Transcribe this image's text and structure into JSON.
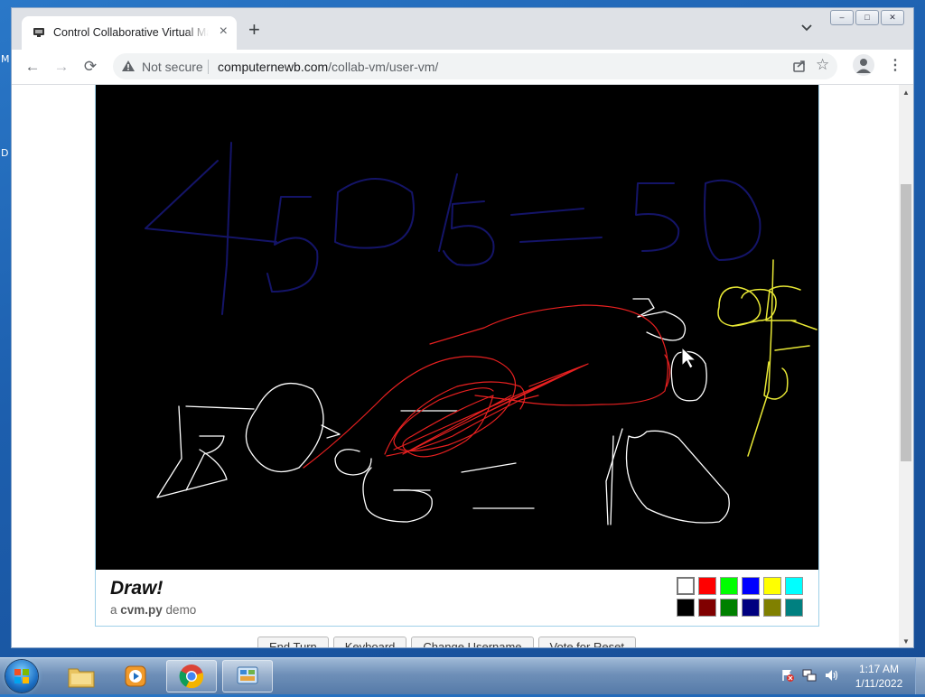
{
  "desktop": {
    "edge_labels": [
      "M",
      "D"
    ]
  },
  "browser": {
    "tab": {
      "title": "Control Collaborative Virtual Ma",
      "close": "×"
    },
    "new_tab": "+",
    "window_buttons": [
      "‒",
      "□",
      "✕"
    ],
    "nav": {
      "back": "←",
      "forward": "→",
      "reload": "⟳"
    },
    "omnibox": {
      "security": "Not secure",
      "url_host": "computernewb.com",
      "url_path": "/collab-vm/user-vm/"
    },
    "star": "☆",
    "menu": "⋮"
  },
  "vm": {
    "title": "Draw!",
    "subtitle_prefix": "a ",
    "subtitle_bold": "cvm.py",
    "subtitle_suffix": " demo",
    "palette": [
      "#ffffff",
      "#ff0000",
      "#00ff00",
      "#0000ff",
      "#ffff00",
      "#00ffff",
      "#000000",
      "#800000",
      "#008000",
      "#000080",
      "#808000",
      "#008080"
    ],
    "buttons": [
      "End Turn",
      "Keyboard",
      "Change Username",
      "Vote for Reset"
    ]
  },
  "taskbar": {
    "time": "1:17 AM",
    "date": "1/11/2022",
    "items": [
      "explorer-icon",
      "media-player-icon",
      "chrome-icon",
      "control-panel-icon"
    ]
  }
}
